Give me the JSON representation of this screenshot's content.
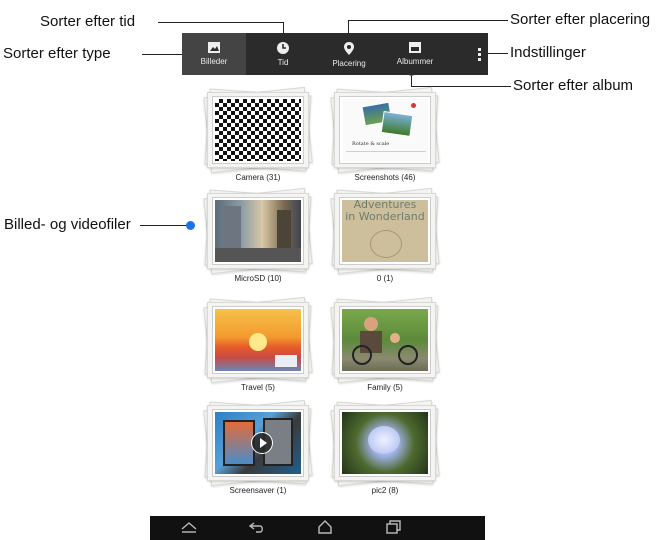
{
  "callouts": {
    "sort_time": "Sorter efter tid",
    "sort_location": "Sorter efter placering",
    "sort_type": "Sorter efter type",
    "settings": "Indstillinger",
    "sort_album": "Sorter efter album",
    "files": "Billed- og videofiler"
  },
  "topbar": {
    "tabs": [
      {
        "label": "Billeder",
        "icon": "image-icon"
      },
      {
        "label": "Tid",
        "icon": "clock-icon"
      },
      {
        "label": "Placering",
        "icon": "location-pin-icon"
      },
      {
        "label": "Albummer",
        "icon": "album-icon"
      }
    ],
    "active_tab": "Billeder"
  },
  "albums": [
    {
      "label": "Camera (31)"
    },
    {
      "label": "Screenshots (46)",
      "photo_text": "Rotate & scale"
    },
    {
      "label": "MicroSD (10)"
    },
    {
      "label": "0 (1)",
      "photo_text_1": "Adventures",
      "photo_text_2": "in Wonderland"
    },
    {
      "label": "Travel (5)"
    },
    {
      "label": "Family (5)"
    },
    {
      "label": "Screensaver (1)"
    },
    {
      "label": "pic2 (8)"
    }
  ],
  "colors": {
    "accent": "#1a73e8",
    "topbar_bg": "#2b2b2b",
    "navbar_bg": "#111111"
  }
}
